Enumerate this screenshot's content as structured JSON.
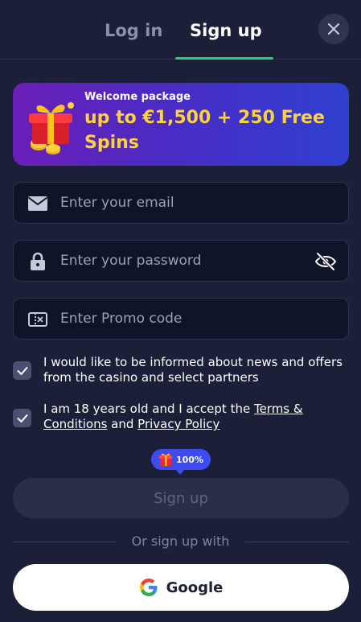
{
  "tabs": {
    "login_label": "Log in",
    "signup_label": "Sign up",
    "active": "signup"
  },
  "banner": {
    "small_text": "Welcome package",
    "big_text": "up to €1,500 + 250 Free Spins",
    "icon": "gift-icon"
  },
  "form": {
    "email": {
      "placeholder": "Enter your email",
      "value": "",
      "icon": "envelope-icon"
    },
    "password": {
      "placeholder": "Enter your password",
      "value": "",
      "icon": "lock-icon",
      "toggle_icon": "eye-slash-icon"
    },
    "promo": {
      "placeholder": "Enter Promo code",
      "value": "",
      "icon": "promo-ticket-icon"
    }
  },
  "consents": {
    "news": {
      "checked": true,
      "text": "I would like to be informed about news and offers from the casino and select partners"
    },
    "age": {
      "checked": true,
      "text_before": "I am 18 years old and I accept the ",
      "terms_link": "Terms & Conditions",
      "text_middle": " and ",
      "privacy_link": "Privacy Policy"
    }
  },
  "bonus_badge": {
    "text": "100%",
    "icon": "gift-icon"
  },
  "submit": {
    "label": "Sign up"
  },
  "alt_signup": {
    "divider_text": "Or sign up with",
    "google_label": "Google",
    "google_icon": "google-icon"
  },
  "colors": {
    "background": "#1b2038",
    "accent_green": "#1ed68a",
    "banner_yellow": "#ffd23a",
    "badge_blue": "#3c4cf0"
  }
}
